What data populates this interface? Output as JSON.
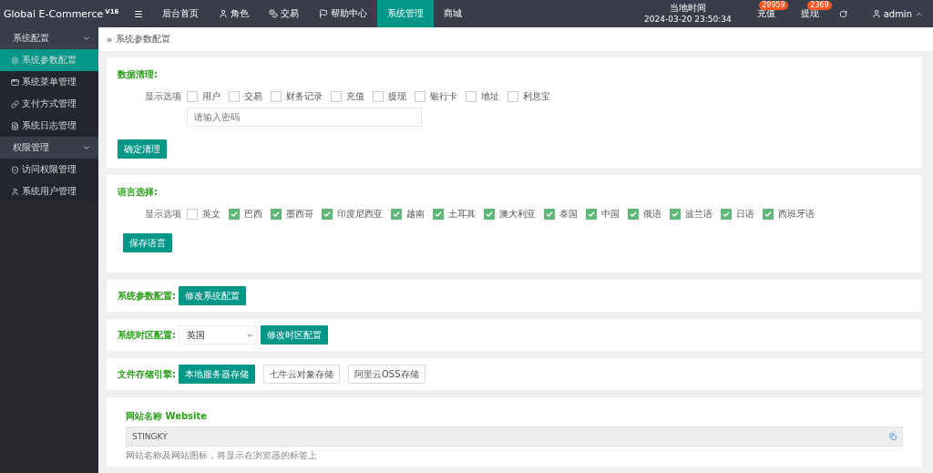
{
  "header": {
    "brand": "Global E-Commerce",
    "version": "V16",
    "menu_toggle": "☰",
    "nav": [
      {
        "label": "后台首页",
        "selected": false
      },
      {
        "label": "角色",
        "selected": false
      },
      {
        "label": "交易",
        "selected": false
      },
      {
        "label": "帮助中心",
        "selected": false
      },
      {
        "label": "系统管理",
        "selected": true
      },
      {
        "label": "商城",
        "selected": false
      }
    ],
    "time_label": "当地时间",
    "time_value": "2024-03-20 23:50:34",
    "counters": [
      {
        "label": "充值",
        "badge": "29959"
      },
      {
        "label": "提现",
        "badge": "2369"
      }
    ],
    "user": "admin"
  },
  "sidebar": [
    {
      "title": "系统配置",
      "expanded": true,
      "items": [
        {
          "label": "系统参数配置",
          "selected": true
        },
        {
          "label": "系统菜单管理",
          "selected": false
        },
        {
          "label": "支付方式管理",
          "selected": false
        },
        {
          "label": "系统日志管理",
          "selected": false
        }
      ]
    },
    {
      "title": "权限管理",
      "expanded": true,
      "items": [
        {
          "label": "访问权限管理",
          "selected": false
        },
        {
          "label": "系统用户管理",
          "selected": false
        }
      ]
    }
  ],
  "breadcrumb_separator": "»",
  "breadcrumb": "系统参数配置",
  "data_cleanup": {
    "title": "数据清理:",
    "options_label": "显示选项",
    "options": [
      {
        "label": "用户",
        "checked": false
      },
      {
        "label": "交易",
        "checked": false
      },
      {
        "label": "财务记录",
        "checked": false
      },
      {
        "label": "充值",
        "checked": false
      },
      {
        "label": "提现",
        "checked": false
      },
      {
        "label": "银行卡",
        "checked": false
      },
      {
        "label": "地址",
        "checked": false
      },
      {
        "label": "利息宝",
        "checked": false
      }
    ],
    "password_placeholder": "请输入密码",
    "button": "确定清理"
  },
  "languages": {
    "title": "语言选择:",
    "options_label": "显示选项",
    "options": [
      {
        "label": "英文",
        "checked": false
      },
      {
        "label": "巴西",
        "checked": true
      },
      {
        "label": "墨西哥",
        "checked": true
      },
      {
        "label": "印度尼西亚",
        "checked": true
      },
      {
        "label": "越南",
        "checked": true
      },
      {
        "label": "土耳其",
        "checked": true
      },
      {
        "label": "澳大利亚",
        "checked": true
      },
      {
        "label": "泰国",
        "checked": true
      },
      {
        "label": "中国",
        "checked": true
      },
      {
        "label": "俄语",
        "checked": true
      },
      {
        "label": "波兰语",
        "checked": true
      },
      {
        "label": "日语",
        "checked": true
      },
      {
        "label": "西班牙语",
        "checked": true
      }
    ],
    "button": "保存语言"
  },
  "system_params": {
    "title": "系统参数配置:",
    "buttons": [
      {
        "label": "修改系统配置",
        "selected": true
      }
    ]
  },
  "timezone": {
    "title": "系统时区配置:",
    "value": "英国",
    "buttons": [
      {
        "label": "修改时区配置",
        "selected": true
      }
    ]
  },
  "storage": {
    "title": "文件存储引擎:",
    "buttons": [
      {
        "label": "本地服务器存储",
        "selected": true
      },
      {
        "label": "七牛云对象存储",
        "selected": false
      },
      {
        "label": "阿里云OSS存储",
        "selected": false
      }
    ]
  },
  "website": {
    "label": "网站名称 Website",
    "value": "STINGKY",
    "hint": "网站名称及网站图标，将显示在浏览器的标签上"
  }
}
